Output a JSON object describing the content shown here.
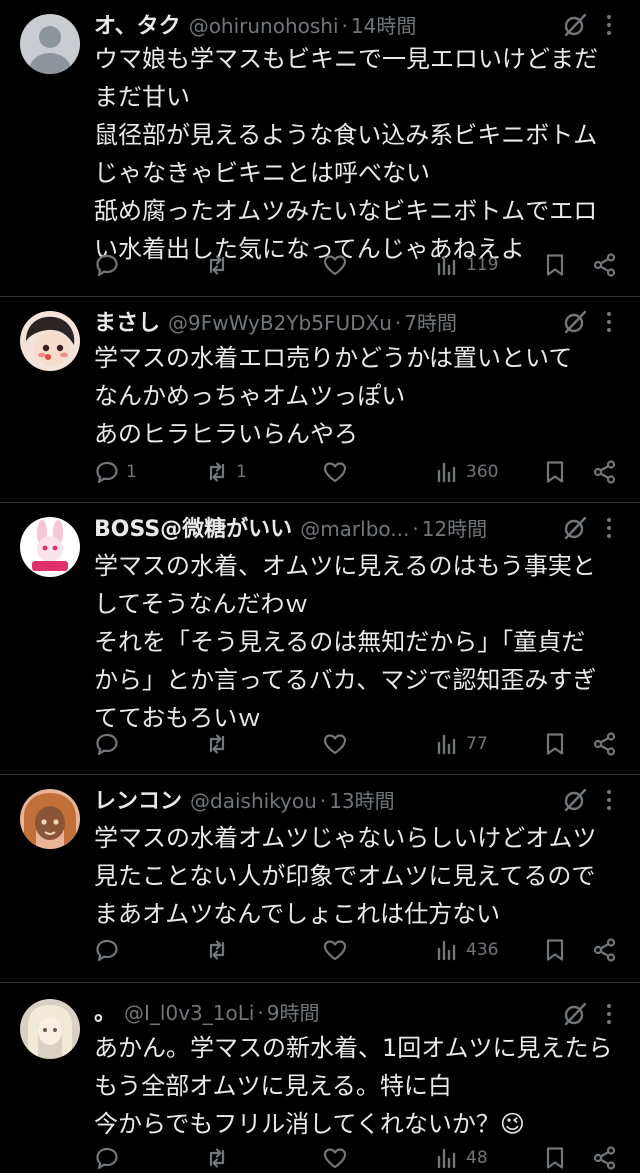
{
  "tweets": [
    {
      "name": "オ、タク",
      "handle": "@ohirunohoshi",
      "time": "14時間",
      "lines": [
        "ウマ娘も学マスもビキニで一見エロいけどまだ",
        "まだ甘い",
        "鼠径部が見えるような食い込み系ビキニボトム",
        "じゃなきゃビキニとは呼べない",
        "舐め腐ったオムツみたいなビキニボトムでエロ",
        "い水着出した気になってんじゃあねえよ"
      ],
      "replies": "",
      "retweets": "",
      "likes": "",
      "views": "119"
    },
    {
      "name": "まさし",
      "handle": "@9FwWyB2Yb5FUDXu",
      "time": "7時間",
      "lines": [
        "学マスの水着エロ売りかどうかは置いといて",
        "なんかめっちゃオムツっぽい",
        "あのヒラヒラいらんやろ"
      ],
      "replies": "1",
      "retweets": "1",
      "likes": "",
      "views": "360"
    },
    {
      "name": "BOSS@微糖がいい",
      "handle": "@marlbo...",
      "time": "12時間",
      "lines": [
        "学マスの水着、オムツに見えるのはもう事実と",
        "してそうなんだわｗ",
        "それを「そう見えるのは無知だから」「童貞だ",
        "から」とか言ってるバカ、マジで認知歪みすぎ",
        "てておもろいｗ"
      ],
      "replies": "",
      "retweets": "",
      "likes": "",
      "views": "77"
    },
    {
      "name": "レンコン",
      "handle": "@daishikyou",
      "time": "13時間",
      "lines": [
        "学マスの水着オムツじゃないらしいけどオムツ",
        "見たことない人が印象でオムツに見えてるので",
        "まあオムツなんでしょこれは仕方ない"
      ],
      "replies": "",
      "retweets": "",
      "likes": "",
      "views": "436"
    },
    {
      "name": "。",
      "handle": "@I_l0v3_1oLi",
      "time": "9時間",
      "lines": [
        "あかん。学マスの新水着、1回オムツに見えたら",
        "もう全部オムツに見える。特に白",
        "今からでもフリル消してくれないか？😉"
      ],
      "replies": "",
      "retweets": "",
      "likes": "",
      "views": "48"
    }
  ],
  "separator": "·",
  "colors": {
    "background": "#000000",
    "text": "#e7e9ea",
    "muted": "#71767b",
    "divider": "#2f3336"
  },
  "icons": [
    "reply-icon",
    "retweet-icon",
    "like-icon",
    "views-icon",
    "bookmark-icon",
    "share-icon",
    "grok-icon",
    "more-icon"
  ]
}
